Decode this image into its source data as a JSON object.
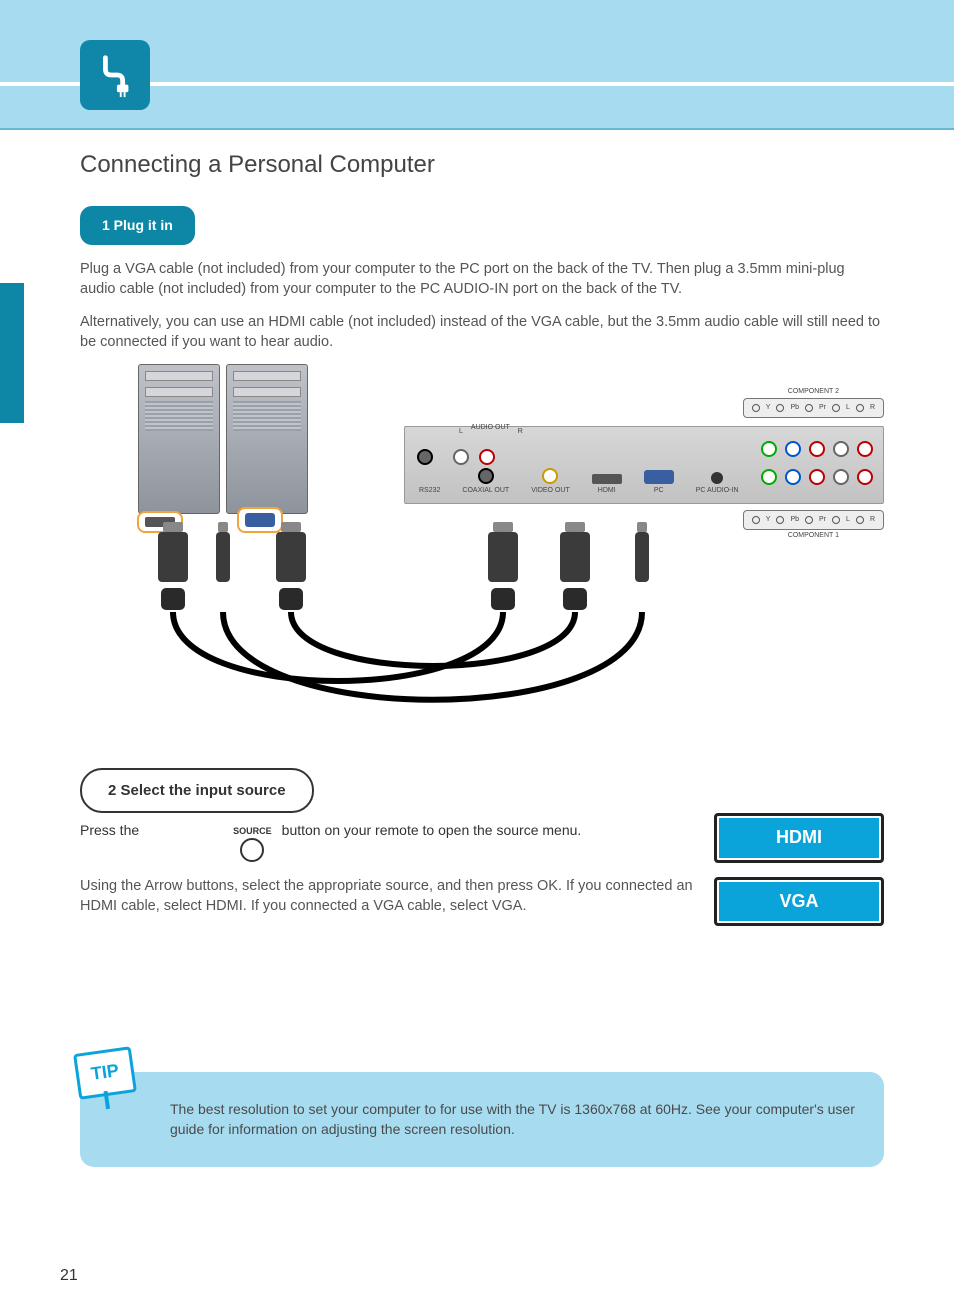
{
  "page": {
    "number": "21",
    "title": "Connecting a Personal Computer",
    "sectionIcon": "plug-icon"
  },
  "step1": {
    "pillLabel": "1 Plug it in",
    "paragraphs": [
      "Plug a VGA cable (not included) from your computer to the PC port on the back of the TV. Then plug a 3.5mm mini-plug audio cable (not included) from your computer to the PC AUDIO-IN port on the back of the TV.",
      "Alternatively, you can use an HDMI cable (not included) instead of the VGA cable, but the 3.5mm audio cable will still need to be connected if you want to hear audio."
    ]
  },
  "diagram": {
    "backPanel": {
      "audioOut": {
        "left": "L",
        "center": "AUDIO OUT",
        "right": "R"
      },
      "labels": [
        "RS232",
        "COAXIAL OUT",
        "VIDEO OUT",
        "HDMI",
        "PC",
        "PC AUDIO-IN"
      ],
      "component1": {
        "title": "COMPONENT 1",
        "pins": [
          "Y",
          "Pb",
          "Pr",
          "L",
          "R"
        ]
      },
      "component2": {
        "title": "COMPONENT 2",
        "pins": [
          "Y",
          "Pb",
          "Pr",
          "L",
          "R"
        ]
      }
    },
    "devices": [
      {
        "name": "pc-1",
        "outputs": [
          "hdmi"
        ]
      },
      {
        "name": "pc-2",
        "outputs": [
          "vga",
          "audio-jack"
        ]
      }
    ],
    "cables": [
      "hdmi-cable",
      "vga-cable",
      "audio-cable"
    ]
  },
  "step2": {
    "bubbleLabel": "2 Select the input source",
    "line1Prefix": "Press the ",
    "sourceLabel": "SOURCE",
    "line1Suffix": " button on your remote to open the source menu.",
    "paragraph2": "Using the Arrow buttons, select the appropriate source, and then press OK. If you connected an HDMI cable, select HDMI. If you connected a VGA cable, select VGA.",
    "buttons": {
      "hdmi": "HDMI",
      "vga": "VGA"
    }
  },
  "tip": {
    "flag": "TIP",
    "text": "The best resolution to set your computer to for use with the TV is 1360x768 at 60Hz. See your computer's user guide for information on adjusting the screen resolution."
  }
}
